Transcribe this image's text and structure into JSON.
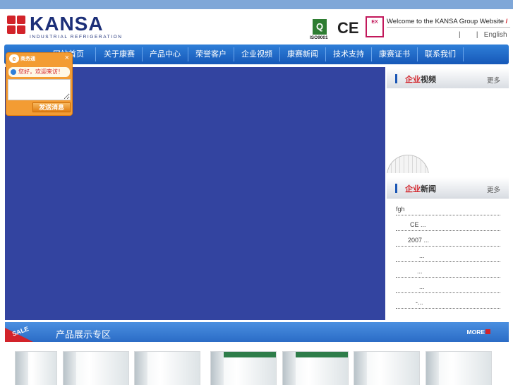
{
  "header": {
    "logo_text": "KANSA",
    "logo_subtitle": "INDUSTRIAL REFRIGERATION",
    "cert_iso_label": "ISO9001",
    "cert_iso_mark": "Q",
    "cert_ce_label": "CE",
    "cert_ex_label": "EX",
    "welcome_text": "Welcome to the KANSA Group Website",
    "welcome_slash": "/",
    "lang_sep1": "|",
    "lang_sep2": "|",
    "lang_english": "English"
  },
  "nav": {
    "items": [
      "网站首页",
      "关于康赛",
      "产品中心",
      "荣誉客户",
      "企业视频",
      "康赛新闻",
      "技术支持",
      "康赛证书",
      "联系我们"
    ]
  },
  "chat": {
    "brand": "商务通",
    "close": "×",
    "greeting": "您好，欢迎来访！",
    "input_placeholder": "",
    "send_label": "发送消息"
  },
  "sidebar": {
    "video": {
      "title_red": "企业",
      "title_rest": "视频",
      "more": "更多"
    },
    "news": {
      "title_red": "企业",
      "title_rest": "新闻",
      "more": "更多",
      "items": [
        "fgh",
        "CE ...",
        "2007 ...",
        "...",
        "...",
        "...",
        "-..."
      ]
    }
  },
  "products": {
    "sale_tag": "SALE",
    "title": "产品展示",
    "title_big": "专区",
    "more": "MORE"
  },
  "colors": {
    "nav": "#1f6ccb",
    "banner": "#3344a0",
    "accent_red": "#d2232a",
    "chat_orange": "#f39c33"
  }
}
